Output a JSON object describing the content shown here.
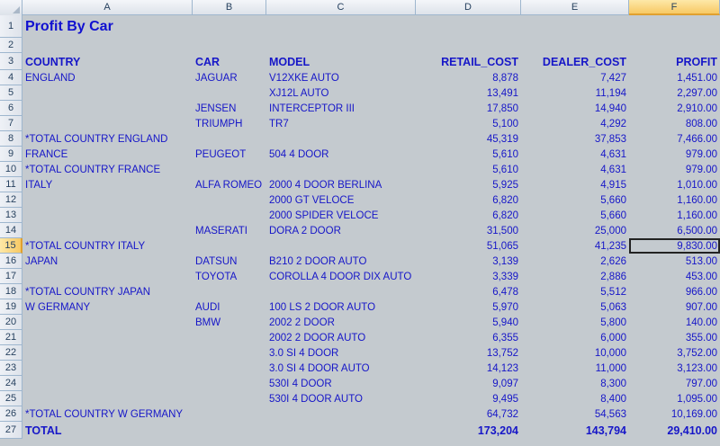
{
  "columns": [
    "A",
    "B",
    "C",
    "D",
    "E",
    "F"
  ],
  "active_column": "F",
  "active_row": 15,
  "title": "Profit By Car",
  "headers": {
    "country": "COUNTRY",
    "car": "CAR",
    "model": "MODEL",
    "retail_cost": "RETAIL_COST",
    "dealer_cost": "DEALER_COST",
    "profit": "PROFIT"
  },
  "rows": [
    {
      "num": 4,
      "country": "ENGLAND",
      "car": "JAGUAR",
      "model": "V12XKE AUTO",
      "retail": "8,878",
      "dealer": "7,427",
      "profit": "1,451.00"
    },
    {
      "num": 5,
      "country": "",
      "car": "",
      "model": "XJ12L AUTO",
      "retail": "13,491",
      "dealer": "11,194",
      "profit": "2,297.00"
    },
    {
      "num": 6,
      "country": "",
      "car": "JENSEN",
      "model": "INTERCEPTOR III",
      "retail": "17,850",
      "dealer": "14,940",
      "profit": "2,910.00"
    },
    {
      "num": 7,
      "country": "",
      "car": "TRIUMPH",
      "model": "TR7",
      "retail": "5,100",
      "dealer": "4,292",
      "profit": "808.00"
    },
    {
      "num": 8,
      "country": "*TOTAL COUNTRY ENGLAND",
      "car": "",
      "model": "",
      "retail": "45,319",
      "dealer": "37,853",
      "profit": "7,466.00"
    },
    {
      "num": 9,
      "country": "FRANCE",
      "car": "PEUGEOT",
      "model": "504 4 DOOR",
      "retail": "5,610",
      "dealer": "4,631",
      "profit": "979.00"
    },
    {
      "num": 10,
      "country": "*TOTAL COUNTRY FRANCE",
      "car": "",
      "model": "",
      "retail": "5,610",
      "dealer": "4,631",
      "profit": "979.00"
    },
    {
      "num": 11,
      "country": "ITALY",
      "car": "ALFA ROMEO",
      "model": "2000 4 DOOR BERLINA",
      "retail": "5,925",
      "dealer": "4,915",
      "profit": "1,010.00"
    },
    {
      "num": 12,
      "country": "",
      "car": "",
      "model": "2000 GT VELOCE",
      "retail": "6,820",
      "dealer": "5,660",
      "profit": "1,160.00"
    },
    {
      "num": 13,
      "country": "",
      "car": "",
      "model": "2000 SPIDER VELOCE",
      "retail": "6,820",
      "dealer": "5,660",
      "profit": "1,160.00"
    },
    {
      "num": 14,
      "country": "",
      "car": "MASERATI",
      "model": "DORA 2 DOOR",
      "retail": "31,500",
      "dealer": "25,000",
      "profit": "6,500.00"
    },
    {
      "num": 15,
      "country": "*TOTAL COUNTRY ITALY",
      "car": "",
      "model": "",
      "retail": "51,065",
      "dealer": "41,235",
      "profit": "9,830.00"
    },
    {
      "num": 16,
      "country": "JAPAN",
      "car": "DATSUN",
      "model": "B210 2 DOOR AUTO",
      "retail": "3,139",
      "dealer": "2,626",
      "profit": "513.00"
    },
    {
      "num": 17,
      "country": "",
      "car": "TOYOTA",
      "model": "COROLLA 4 DOOR DIX AUTO",
      "retail": "3,339",
      "dealer": "2,886",
      "profit": "453.00"
    },
    {
      "num": 18,
      "country": "*TOTAL COUNTRY JAPAN",
      "car": "",
      "model": "",
      "retail": "6,478",
      "dealer": "5,512",
      "profit": "966.00"
    },
    {
      "num": 19,
      "country": "W GERMANY",
      "car": "AUDI",
      "model": "100 LS 2 DOOR AUTO",
      "retail": "5,970",
      "dealer": "5,063",
      "profit": "907.00"
    },
    {
      "num": 20,
      "country": "",
      "car": "BMW",
      "model": "2002 2 DOOR",
      "retail": "5,940",
      "dealer": "5,800",
      "profit": "140.00"
    },
    {
      "num": 21,
      "country": "",
      "car": "",
      "model": "2002 2 DOOR AUTO",
      "retail": "6,355",
      "dealer": "6,000",
      "profit": "355.00"
    },
    {
      "num": 22,
      "country": "",
      "car": "",
      "model": "3.0 SI 4 DOOR",
      "retail": "13,752",
      "dealer": "10,000",
      "profit": "3,752.00"
    },
    {
      "num": 23,
      "country": "",
      "car": "",
      "model": "3.0 SI 4 DOOR AUTO",
      "retail": "14,123",
      "dealer": "11,000",
      "profit": "3,123.00"
    },
    {
      "num": 24,
      "country": "",
      "car": "",
      "model": "530I 4 DOOR",
      "retail": "9,097",
      "dealer": "8,300",
      "profit": "797.00"
    },
    {
      "num": 25,
      "country": "",
      "car": "",
      "model": "530I 4 DOOR AUTO",
      "retail": "9,495",
      "dealer": "8,400",
      "profit": "1,095.00"
    },
    {
      "num": 26,
      "country": "*TOTAL COUNTRY W GERMANY",
      "car": "",
      "model": "",
      "retail": "64,732",
      "dealer": "54,563",
      "profit": "10,169.00"
    }
  ],
  "total": {
    "num": 27,
    "label": "TOTAL",
    "retail": "173,204",
    "dealer": "143,794",
    "profit": "29,410.00"
  }
}
